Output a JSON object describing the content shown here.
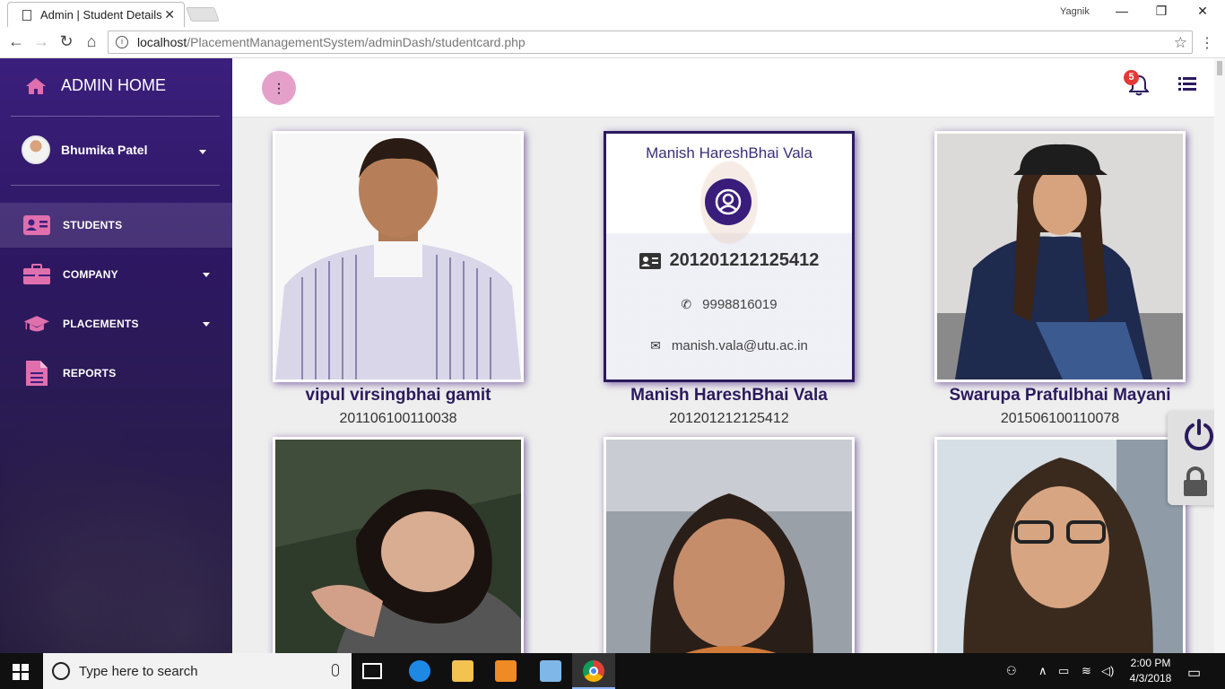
{
  "browser": {
    "tab_title": "Admin | Student Details",
    "tab_close": "✕",
    "window_user": "Yagnik",
    "url_host": "localhost",
    "url_path": "/PlacementManagementSystem/adminDash/studentcard.php"
  },
  "sidebar": {
    "brand": "ADMIN HOME",
    "user_name": "Bhumika Patel",
    "items": [
      {
        "label": "STUDENTS",
        "icon": "id-card-icon",
        "active": true
      },
      {
        "label": "COMPANY",
        "icon": "briefcase-icon",
        "has_caret": true
      },
      {
        "label": "PLACEMENTS",
        "icon": "graduation-cap-icon",
        "has_caret": true
      },
      {
        "label": "REPORTS",
        "icon": "file-icon"
      }
    ]
  },
  "topbar": {
    "menu_dots": "⋮",
    "notification_count": "5"
  },
  "cards": [
    {
      "name": "vipul virsingbhai gamit",
      "enrollment": "201106100110038"
    },
    {
      "name": "Manish HareshBhai Vala",
      "enrollment": "201201212125412",
      "hover": {
        "name": "Manish HareshBhai Vala",
        "enrollment": "201201212125412",
        "phone": "9998816019",
        "email": "manish.vala@utu.ac.in"
      }
    },
    {
      "name": "Swarupa Prafulbhai Mayani",
      "enrollment": "201506100110078"
    },
    {
      "name": "",
      "enrollment": ""
    },
    {
      "name": "",
      "enrollment": ""
    },
    {
      "name": "",
      "enrollment": ""
    }
  ],
  "taskbar": {
    "search_placeholder": "Type here to search",
    "time": "2:00 PM",
    "date": "4/3/2018"
  },
  "colors": {
    "sidebar": "#3b1f7d",
    "accent_purple": "#2b1a5e",
    "icon_pink": "#e06fae",
    "badge_red": "#e53935"
  }
}
